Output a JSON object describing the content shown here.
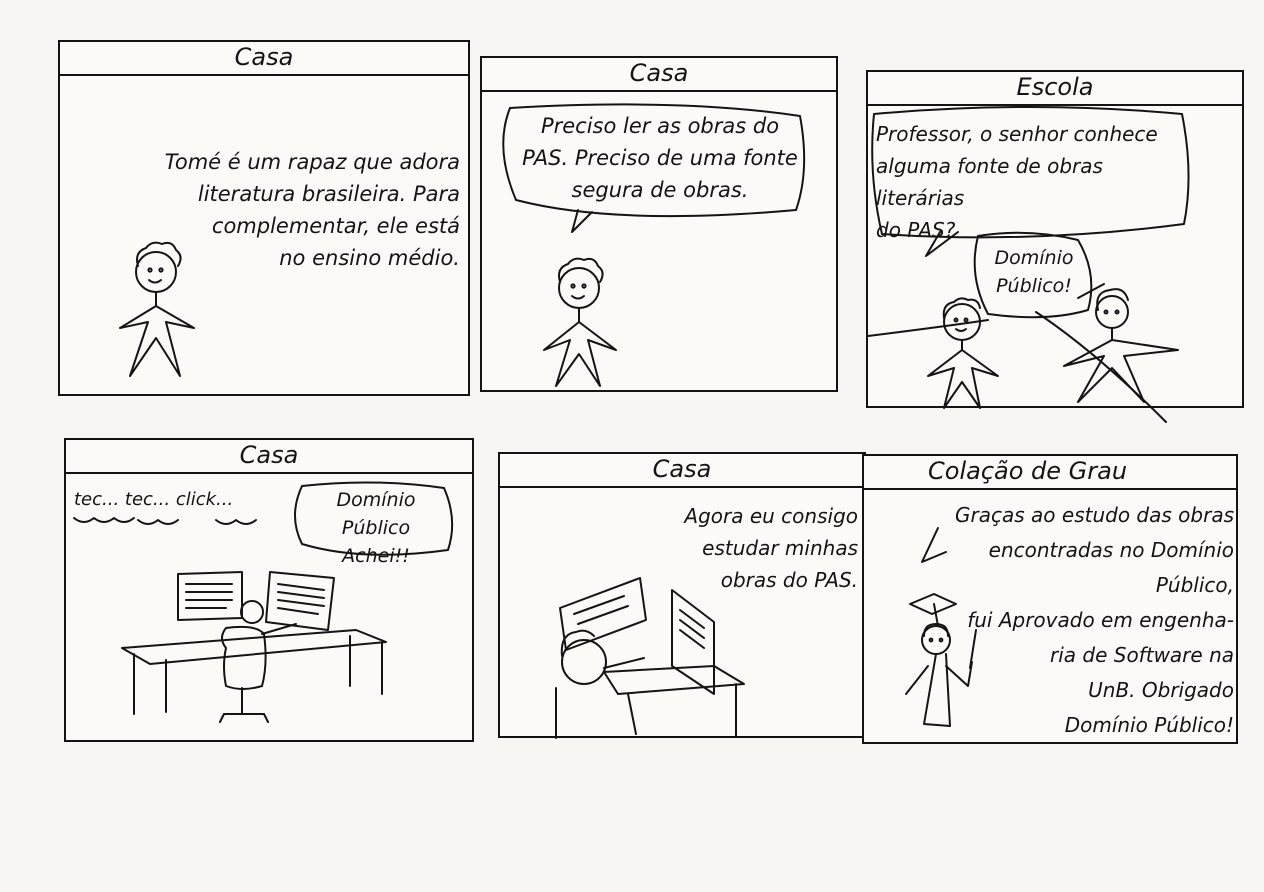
{
  "panels": [
    {
      "title": "Casa",
      "narration": "Tomé é um rapaz que adora\nliteratura brasileira. Para\ncomplementar, ele está\nno ensino médio."
    },
    {
      "title": "Casa",
      "speech": "Preciso ler as obras do\nPAS. Preciso de uma fonte\nsegura de obras."
    },
    {
      "title": "Escola",
      "speech_student": "Professor, o senhor conhece\nalguma fonte de obras literárias\ndo PAS?",
      "speech_teacher": "Domínio\nPúblico!"
    },
    {
      "title": "Casa",
      "sfx": "tec... tec... click...",
      "speech": "Domínio Público\nAchei!!"
    },
    {
      "title": "Casa",
      "narration": "Agora eu consigo\nestudar minhas\nobras do PAS."
    },
    {
      "title": "Colação de Grau",
      "speech": "Graças ao estudo das obras\nencontradas no Domínio Público,\nfui Aprovado em engenha-\nria de Software na\nUnB. Obrigado\nDomínio Público!"
    }
  ]
}
